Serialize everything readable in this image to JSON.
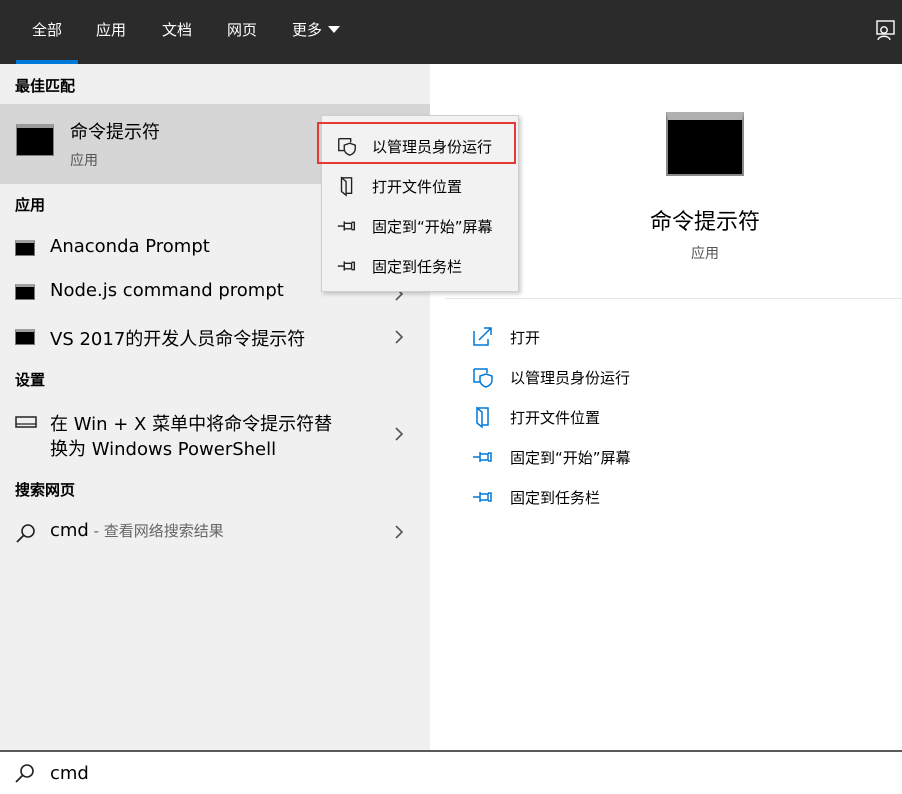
{
  "topbar": {
    "tabs": [
      {
        "label": "全部",
        "active": true
      },
      {
        "label": "应用"
      },
      {
        "label": "文档"
      },
      {
        "label": "网页"
      },
      {
        "label": "更多"
      }
    ],
    "feedback_icon": "feedback-icon"
  },
  "left": {
    "best_match_header": "最佳匹配",
    "best_match": {
      "title": "命令提示符",
      "subtitle": "应用",
      "icon": "cmd-icon"
    },
    "apps_header": "应用",
    "apps": [
      {
        "label": "Anaconda Prompt",
        "icon": "cmd-icon"
      },
      {
        "label": "Node.js command prompt",
        "icon": "cmd-icon"
      },
      {
        "label": "VS 2017的开发人员命令提示符",
        "icon": "cmd-icon"
      }
    ],
    "settings_header": "设置",
    "settings": [
      {
        "line1": "在 Win + X 菜单中将命令提示符替",
        "line2": "换为 Windows PowerShell",
        "icon": "monitor-icon"
      }
    ],
    "web_header": "搜索网页",
    "web": [
      {
        "query": "cmd",
        "suffix": " - 查看网络搜索结果",
        "icon": "search-icon"
      }
    ]
  },
  "right": {
    "title": "命令提示符",
    "subtitle": "应用",
    "actions": [
      {
        "label": "打开",
        "icon": "open-icon"
      },
      {
        "label": "以管理员身份运行",
        "icon": "shield-icon"
      },
      {
        "label": "打开文件位置",
        "icon": "folder-icon"
      },
      {
        "label": "固定到“开始”屏幕",
        "icon": "pin-icon"
      },
      {
        "label": "固定到任务栏",
        "icon": "pin-icon"
      }
    ]
  },
  "context_menu": {
    "items": [
      {
        "label": "以管理员身份运行",
        "icon": "shield-icon",
        "highlighted": true
      },
      {
        "label": "打开文件位置",
        "icon": "folder-icon"
      },
      {
        "label": "固定到“开始”屏幕",
        "icon": "pin-icon"
      },
      {
        "label": "固定到任务栏",
        "icon": "pin-icon"
      }
    ]
  },
  "search": {
    "value": "cmd"
  },
  "colors": {
    "accent": "#0078d7",
    "highlight_border": "#e53935",
    "topbar_bg": "#2b2b2b",
    "left_bg": "#f0f0f0",
    "selected_bg": "#d6d6d6"
  }
}
